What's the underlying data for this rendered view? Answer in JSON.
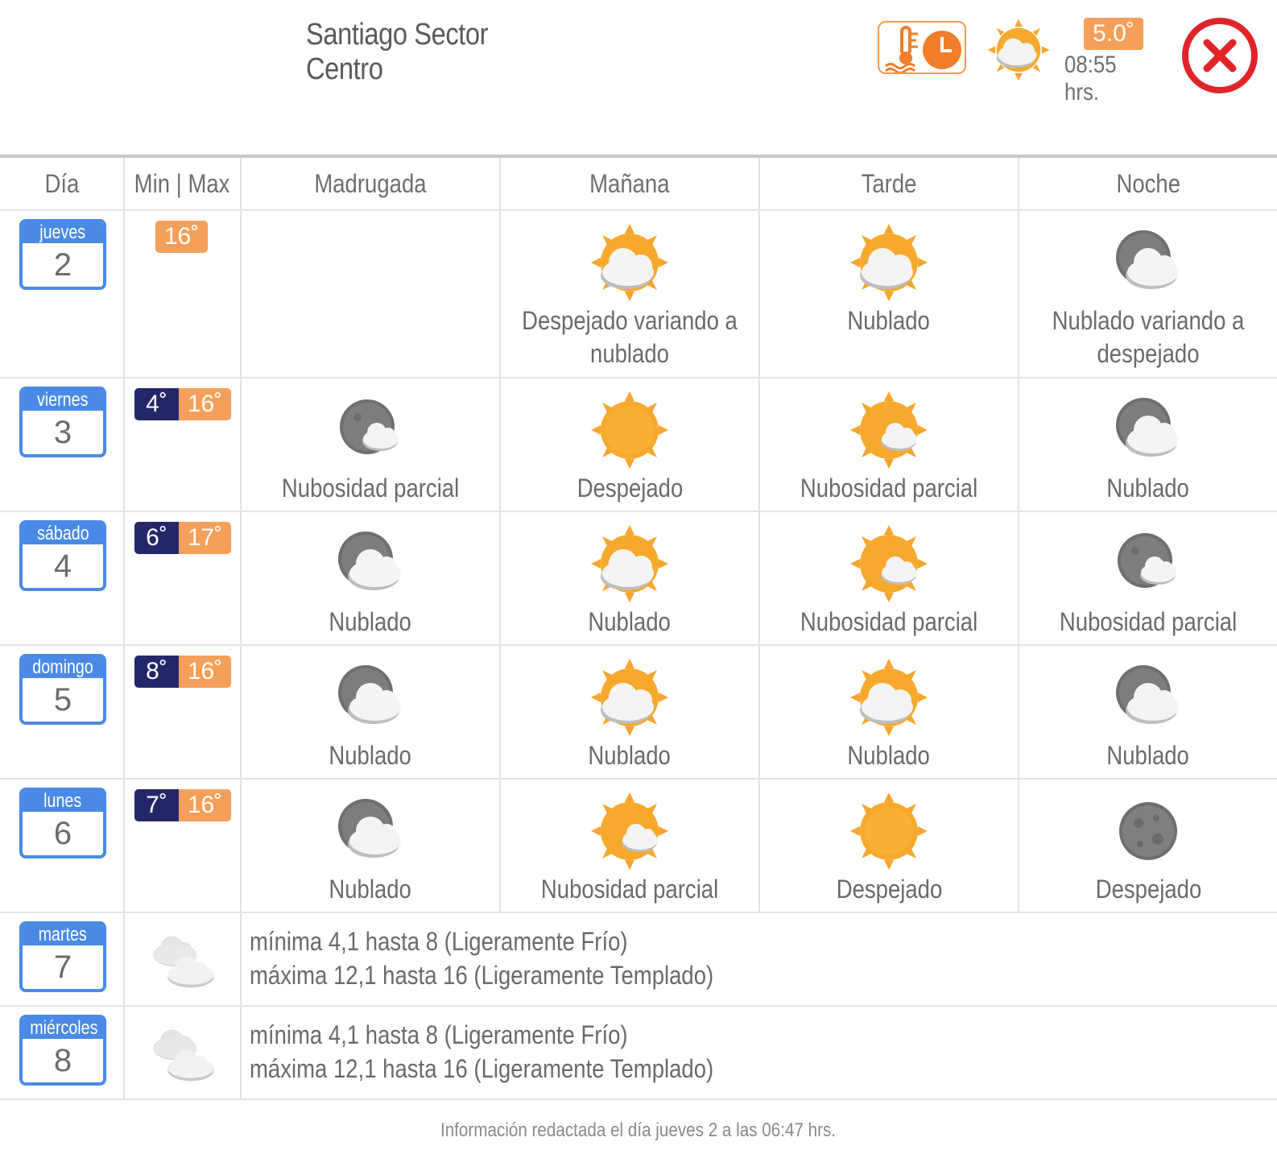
{
  "header": {
    "title": "Santiago Sector Centro",
    "current_temp": "5.0˚",
    "current_time": "08:55 hrs.",
    "current_icon": "sun-cloud-icon",
    "thermo_button_icon": "thermometer-clock-icon",
    "close_icon": "close-icon"
  },
  "columns": [
    "Día",
    "Min | Max",
    "Madrugada",
    "Mañana",
    "Tarde",
    "Noche"
  ],
  "days": [
    {
      "weekday": "jueves",
      "day": "2",
      "min": "",
      "max": "16˚",
      "periods": [
        {
          "icon": "",
          "text": ""
        },
        {
          "icon": "sun-cloud-icon",
          "text": "Despejado variando a nublado"
        },
        {
          "icon": "sun-cloud-icon",
          "text": "Nublado"
        },
        {
          "icon": "moon-cloud-icon",
          "text": "Nublado variando a despejado"
        }
      ]
    },
    {
      "weekday": "viernes",
      "day": "3",
      "min": "4˚",
      "max": "16˚",
      "periods": [
        {
          "icon": "moon-cloud-partial-icon",
          "text": "Nubosidad parcial"
        },
        {
          "icon": "sun-icon",
          "text": "Despejado"
        },
        {
          "icon": "sun-cloud-partial-icon",
          "text": "Nubosidad parcial"
        },
        {
          "icon": "moon-cloud-icon",
          "text": "Nublado"
        }
      ]
    },
    {
      "weekday": "sábado",
      "day": "4",
      "min": "6˚",
      "max": "17˚",
      "periods": [
        {
          "icon": "moon-cloud-icon",
          "text": "Nublado"
        },
        {
          "icon": "sun-cloud-icon",
          "text": "Nublado"
        },
        {
          "icon": "sun-cloud-partial-icon",
          "text": "Nubosidad parcial"
        },
        {
          "icon": "moon-cloud-partial-icon",
          "text": "Nubosidad parcial"
        }
      ]
    },
    {
      "weekday": "domingo",
      "day": "5",
      "min": "8˚",
      "max": "16˚",
      "periods": [
        {
          "icon": "moon-cloud-icon",
          "text": "Nublado"
        },
        {
          "icon": "sun-cloud-icon",
          "text": "Nublado"
        },
        {
          "icon": "sun-cloud-icon",
          "text": "Nublado"
        },
        {
          "icon": "moon-cloud-icon",
          "text": "Nublado"
        }
      ]
    },
    {
      "weekday": "lunes",
      "day": "6",
      "min": "7˚",
      "max": "16˚",
      "periods": [
        {
          "icon": "moon-cloud-icon",
          "text": "Nublado"
        },
        {
          "icon": "sun-cloud-partial-icon",
          "text": "Nubosidad parcial"
        },
        {
          "icon": "sun-icon",
          "text": "Despejado"
        },
        {
          "icon": "moon-icon",
          "text": "Despejado"
        }
      ]
    }
  ],
  "extended": [
    {
      "weekday": "martes",
      "day": "7",
      "icon": "clouds-icon",
      "line1": "mínima 4,1 hasta 8 (Ligeramente Frío)",
      "line2": "máxima 12,1 hasta 16 (Ligeramente Templado)"
    },
    {
      "weekday": "miércoles",
      "day": "8",
      "icon": "clouds-icon",
      "line1": "mínima 4,1 hasta 8 (Ligeramente Frío)",
      "line2": "máxima 12,1 hasta 16 (Ligeramente Templado)"
    }
  ],
  "footer": "Información redactada el día jueves 2 a las 06:47 hrs.",
  "colors": {
    "calendar": "#4a8ae6",
    "min": "#23276a",
    "max": "#f5a05a",
    "close": "#e0242a"
  }
}
